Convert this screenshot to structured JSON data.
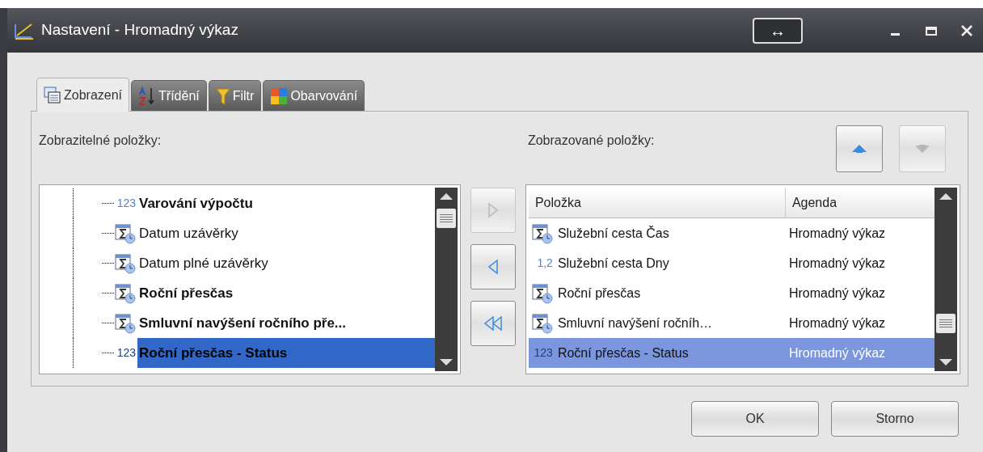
{
  "window": {
    "title": "Nastavení - Hromadný výkaz",
    "center_button": "↔"
  },
  "tabs": [
    {
      "label": "Zobrazení",
      "kind": "table",
      "selected": true
    },
    {
      "label": "Třídění",
      "kind": "sort",
      "selected": false
    },
    {
      "label": "Filtr",
      "kind": "filter",
      "selected": false
    },
    {
      "label": "Obarvování",
      "kind": "colors",
      "selected": false
    }
  ],
  "available": {
    "label": "Zobrazitelné položky:",
    "items": [
      {
        "kind": "number",
        "badge": "123",
        "label": "Varování výpočtu",
        "bold": true,
        "selected": false
      },
      {
        "kind": "formula",
        "label": "Datum uzávěrky",
        "bold": false,
        "selected": false
      },
      {
        "kind": "formula",
        "label": "Datum plné uzávěrky",
        "bold": false,
        "selected": false
      },
      {
        "kind": "formula",
        "label": "Roční přesčas",
        "bold": true,
        "selected": false
      },
      {
        "kind": "formula",
        "label": "Smluvní navýšení ročního pře...",
        "bold": true,
        "selected": false
      },
      {
        "kind": "number",
        "badge": "123",
        "label": "Roční přesčas - Status",
        "bold": true,
        "selected": true
      }
    ]
  },
  "move_buttons": [
    {
      "kind": "right",
      "disabled": true
    },
    {
      "kind": "left",
      "disabled": false
    },
    {
      "kind": "all_left",
      "disabled": false
    }
  ],
  "shown": {
    "label": "Zobrazované položky:",
    "order_buttons": [
      {
        "kind": "up",
        "disabled": false
      },
      {
        "kind": "down",
        "disabled": true
      }
    ],
    "columns": [
      "Položka",
      "Agenda"
    ],
    "rows": [
      {
        "kind": "formula",
        "label": "Služební cesta Čas",
        "agenda": "Hromadný výkaz",
        "selected": false
      },
      {
        "kind": "decimal",
        "badge": "1,2",
        "label": "Služební cesta Dny",
        "agenda": "Hromadný výkaz",
        "selected": false
      },
      {
        "kind": "formula",
        "label": "Roční přesčas",
        "agenda": "Hromadný výkaz",
        "selected": false
      },
      {
        "kind": "formula",
        "label": "Smluvní navýšení ročníh…",
        "agenda": "Hromadný výkaz",
        "selected": false
      },
      {
        "kind": "number",
        "badge": "123",
        "label": "Roční přesčas - Status",
        "agenda": "Hromadný výkaz",
        "selected": true
      }
    ]
  },
  "buttons": [
    "OK",
    "Storno"
  ]
}
